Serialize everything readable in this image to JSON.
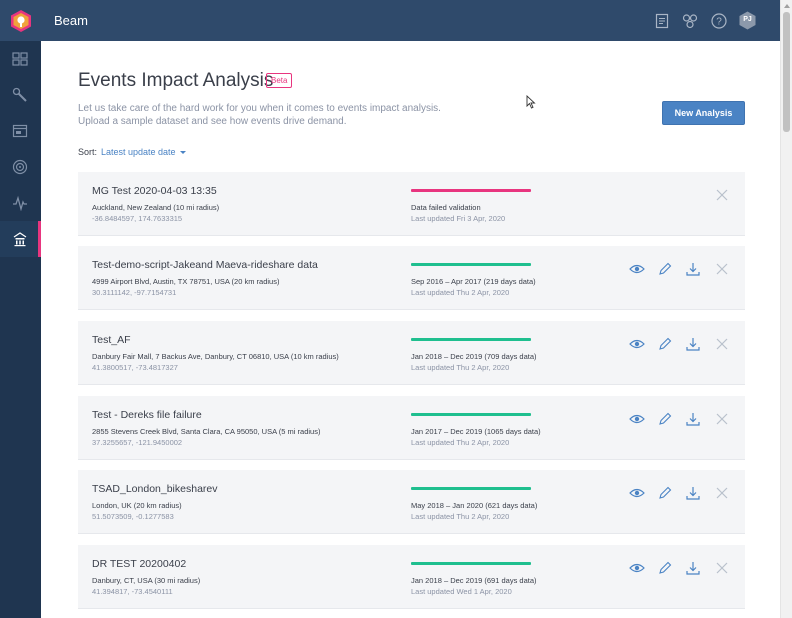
{
  "app": {
    "title": "Beam"
  },
  "header_icons": [
    "document-icon",
    "apps-icon",
    "help-icon"
  ],
  "user": {
    "initials": "PJ"
  },
  "sidebar": {
    "items": [
      {
        "icon": "dashboard-icon"
      },
      {
        "icon": "wrench-icon"
      },
      {
        "icon": "browser-window-icon"
      },
      {
        "icon": "target-icon"
      },
      {
        "icon": "pulse-icon"
      },
      {
        "icon": "events-icon",
        "active": true
      }
    ]
  },
  "page": {
    "title": "Events Impact Analysis",
    "badge": "Beta",
    "intro_line1": "Let us take care of the hard work for you when it comes to events impact analysis.",
    "intro_line2": "Upload a sample dataset and see how events drive demand.",
    "new_button": "New Analysis",
    "sort_label": "Sort:",
    "sort_value": "Latest update date"
  },
  "colors": {
    "accent": "#e8357f",
    "ok": "#1fbf8f",
    "primary": "#4a83c4",
    "header": "#2f4a6b",
    "sidebar": "#1f3550"
  },
  "analyses": [
    {
      "title": "MG Test 2020-04-03 13:35",
      "address": "Auckland, New Zealand (10 mi radius)",
      "coords": "-36.8484597, 174.7633315",
      "status": "failed",
      "status_text": "Data failed validation",
      "updated": "Last updated Fri 3 Apr, 2020",
      "actions": [
        "delete"
      ]
    },
    {
      "title": "Test-demo-script-Jakeand Maeva-rideshare data",
      "address": "4999 Airport Blvd, Austin, TX 78751, USA (20 km radius)",
      "coords": "30.3111142, -97.7154731",
      "status": "ok",
      "status_text": "Sep 2016 – Apr 2017 (219 days data)",
      "updated": "Last updated Thu 2 Apr, 2020",
      "actions": [
        "view",
        "edit",
        "download",
        "delete"
      ]
    },
    {
      "title": "Test_AF",
      "address": "Danbury Fair Mall, 7 Backus Ave, Danbury, CT 06810, USA (10 km radius)",
      "coords": "41.3800517, -73.4817327",
      "status": "ok",
      "status_text": "Jan 2018 – Dec 2019 (709 days data)",
      "updated": "Last updated Thu 2 Apr, 2020",
      "actions": [
        "view",
        "edit",
        "download",
        "delete"
      ]
    },
    {
      "title": "Test - Dereks file failure",
      "address": "2855 Stevens Creek Blvd, Santa Clara, CA 95050, USA (5 mi radius)",
      "coords": "37.3255657, -121.9450002",
      "status": "ok",
      "status_text": "Jan 2017 – Dec 2019 (1065 days data)",
      "updated": "Last updated Thu 2 Apr, 2020",
      "actions": [
        "view",
        "edit",
        "download",
        "delete"
      ]
    },
    {
      "title": "TSAD_London_bikesharev",
      "address": "London, UK (20 km radius)",
      "coords": "51.5073509, -0.1277583",
      "status": "ok",
      "status_text": "May 2018 – Jan 2020 (621 days data)",
      "updated": "Last updated Thu 2 Apr, 2020",
      "actions": [
        "view",
        "edit",
        "download",
        "delete"
      ]
    },
    {
      "title": "DR TEST 20200402",
      "address": "Danbury, CT, USA (30 mi radius)",
      "coords": "41.394817, -73.4540111",
      "status": "ok",
      "status_text": "Jan 2018 – Dec 2019 (691 days data)",
      "updated": "Last updated Wed 1 Apr, 2020",
      "actions": [
        "view",
        "edit",
        "download",
        "delete"
      ]
    }
  ]
}
